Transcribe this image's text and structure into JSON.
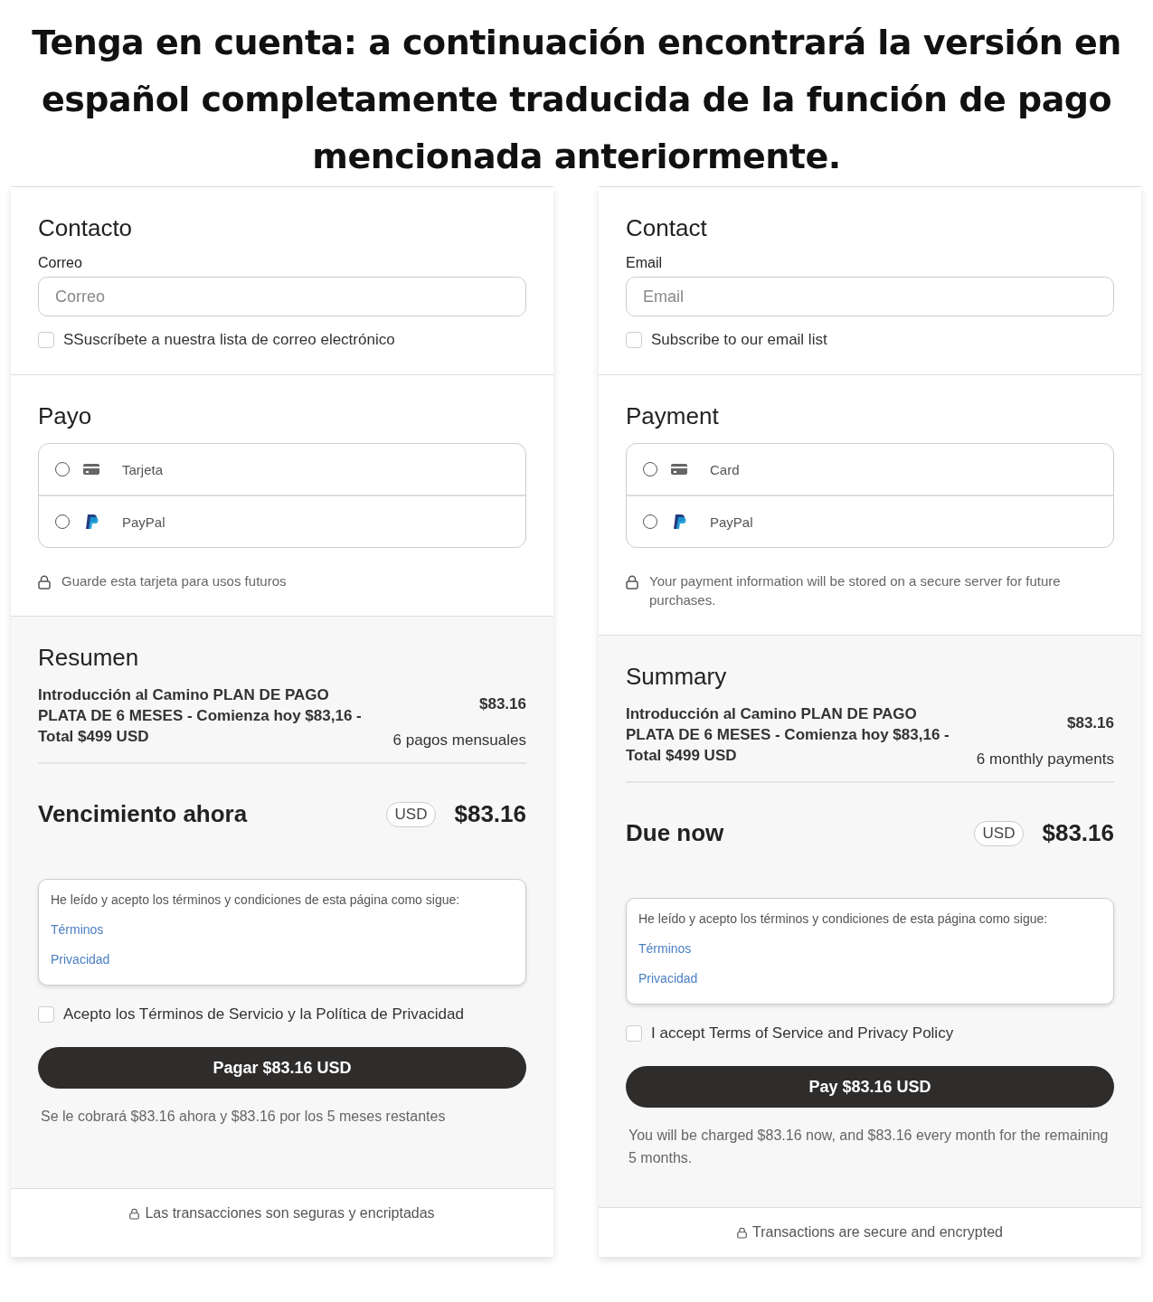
{
  "notice": "Tenga en cuenta: a continuación encontrará la versión en español completamente traducida de la función de pago mencionada anteriormente.",
  "panels": [
    {
      "contact": {
        "title": "Contacto",
        "email_label": "Correo",
        "email_placeholder": "Correo",
        "subscribe": {
          "label": "SSuscríbete a nuestra lista de correo electrónico",
          "checked": false
        }
      },
      "payment": {
        "title": "Payo",
        "methods": [
          {
            "kind": "card",
            "label": "Tarjeta",
            "selected": false
          },
          {
            "kind": "paypal",
            "label": "PayPal",
            "selected": false
          }
        ],
        "note": "Guarde esta tarjeta para usos futuros"
      },
      "summary": {
        "title": "Resumen",
        "product": "Introducción al Camino PLAN DE PAGO PLATA DE 6 MESES - Comienza hoy $83,16 - Total $499 USD",
        "price": "$83.16",
        "schedule": "6 pagos mensuales"
      },
      "due": {
        "label": "Vencimiento ahora",
        "currency": "USD",
        "amount": "$83.16"
      },
      "terms": {
        "intro": "He leído y acepto los términos y condiciones de esta página como sigue:",
        "links": [
          "Términos",
          "Privacidad"
        ]
      },
      "accept": {
        "label": "Acepto los Términos de Servicio y la Política de Privacidad",
        "checked": false
      },
      "pay_button": "Pagar $83.16 USD",
      "charge_note": "Se le cobrará $83.16 ahora y $83.16 por los 5 meses restantes",
      "footer": "Las transacciones son seguras y encriptadas"
    },
    {
      "contact": {
        "title": "Contact",
        "email_label": "Email",
        "email_placeholder": "Email",
        "subscribe": {
          "label": "Subscribe to our email list",
          "checked": false
        }
      },
      "payment": {
        "title": "Payment",
        "methods": [
          {
            "kind": "card",
            "label": "Card",
            "selected": false
          },
          {
            "kind": "paypal",
            "label": "PayPal",
            "selected": false
          }
        ],
        "note": "Your payment information will be stored on a secure server for future purchases."
      },
      "summary": {
        "title": "Summary",
        "product": "Introducción al Camino PLAN DE PAGO PLATA DE 6 MESES - Comienza hoy $83,16 - Total $499 USD",
        "price": "$83.16",
        "schedule": "6 monthly payments"
      },
      "due": {
        "label": "Due now",
        "currency": "USD",
        "amount": "$83.16"
      },
      "terms": {
        "intro": "He leído y acepto los términos y condiciones de esta página como sigue:",
        "links": [
          "Términos",
          "Privacidad"
        ]
      },
      "accept": {
        "label": "I accept Terms of Service and Privacy Policy",
        "checked": false
      },
      "pay_button": "Pay $83.16 USD",
      "charge_note": "You will be charged $83.16 now, and $83.16 every month for the remaining 5 months.",
      "footer": "Transactions are secure and encrypted"
    }
  ]
}
